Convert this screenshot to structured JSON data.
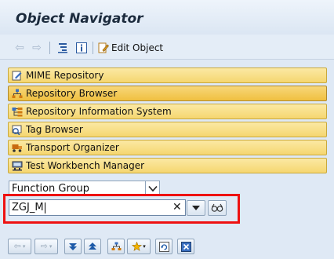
{
  "window": {
    "title": "Object Navigator"
  },
  "toolbar": {
    "back_icon": "arrow-left-icon",
    "forward_icon": "arrow-right-icon",
    "hierarchy_icon": "hierarchy-icon",
    "info_icon": "info-icon",
    "edit_object_label": "Edit Object"
  },
  "nav": {
    "items": [
      {
        "label": "MIME Repository",
        "icon": "mime-repository-icon"
      },
      {
        "label": "Repository Browser",
        "icon": "repository-browser-icon",
        "active": true
      },
      {
        "label": "Repository Information System",
        "icon": "info-system-icon"
      },
      {
        "label": "Tag Browser",
        "icon": "tag-browser-icon"
      },
      {
        "label": "Transport Organizer",
        "icon": "transport-organizer-icon"
      },
      {
        "label": "Test Workbench Manager",
        "icon": "test-workbench-icon"
      }
    ]
  },
  "object_type": {
    "selected": "Function Group"
  },
  "object_name": {
    "value": "ZGJ_M"
  },
  "colors": {
    "background": "#dfe9f5",
    "nav_button": "#f5d670",
    "highlight_frame": "#ee1111"
  }
}
